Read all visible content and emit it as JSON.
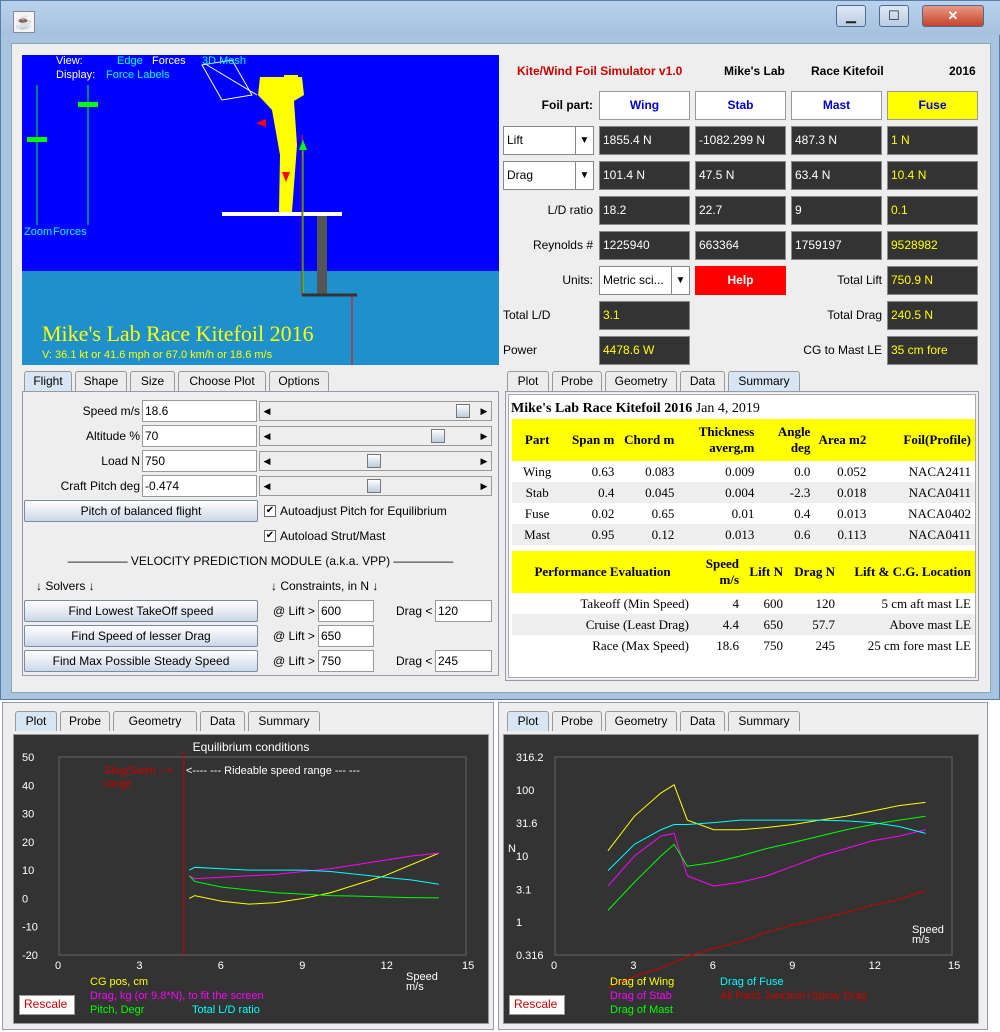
{
  "window": {
    "min_label": "▁",
    "max_label": "☐",
    "close_label": "✕",
    "app_icon": "java-cup-icon"
  },
  "scene": {
    "view_label": "View:",
    "edge_label": "Edge",
    "forces_label": "Forces",
    "mesh_label": "3D Mesh",
    "display_label": "Display:",
    "force_labels_label": "Force Labels",
    "zoom_label": "Zoom",
    "forces_slider_label": "Forces",
    "title": "Mike's Lab Race Kitefoil 2016",
    "velocity": "V: 36.1 kt or 41.6 mph or 67.0 km/h or 18.6 m/s"
  },
  "header": {
    "app_name": "Kite/Wind Foil Simulator v1.0",
    "lab": "Mike's Lab",
    "project": "Race Kitefoil",
    "year": "2016"
  },
  "foil": {
    "part_label": "Foil part:",
    "parts": [
      "Wing",
      "Stab",
      "Mast",
      "Fuse"
    ],
    "lift_select": "Lift",
    "drag_select": "Drag",
    "lift": [
      "1855.4 N",
      "-1082.299 N",
      "487.3 N",
      "1 N"
    ],
    "drag": [
      "101.4 N",
      "47.5 N",
      "63.4 N",
      "10.4 N"
    ],
    "ld_label": "L/D ratio",
    "ld": [
      "18.2",
      "22.7",
      "9",
      "0.1"
    ],
    "re_label": "Reynolds #",
    "re": [
      "1225940",
      "663364",
      "1759197",
      "9528982"
    ],
    "units_label": "Units:",
    "units_value": "Metric sci...",
    "help": "Help",
    "total_lift_label": "Total Lift",
    "total_lift": "750.9 N",
    "total_ld_label": "Total L/D",
    "total_ld": "3.1",
    "total_drag_label": "Total Drag",
    "total_drag": "240.5 N",
    "power_label": "Power",
    "power": "4478.6 W",
    "cg_label": "CG to Mast LE",
    "cg": "35 cm fore"
  },
  "left_tabs": [
    "Flight",
    "Shape",
    "Size",
    "Choose Plot",
    "Options"
  ],
  "flight": {
    "speed_label": "Speed m/s",
    "speed": "18.6",
    "alt_label": "Altitude %",
    "alt": "70",
    "load_label": "Load N",
    "load": "750",
    "pitch_label": "Craft Pitch deg",
    "pitch": "-0.474",
    "balanced_btn": "Pitch of balanced flight",
    "autoadjust": "Autoadjust Pitch for Equilibrium",
    "autoload": "Autoload Strut/Mast",
    "vpp_title": "—————  VELOCITY PREDICTION MODULE (a.k.a. VPP)  —————",
    "solvers": "↓   Solvers   ↓",
    "constraints": "↓   Constraints, in N   ↓",
    "btn1": "Find Lowest TakeOff speed",
    "btn2": "Find Speed of lesser Drag",
    "btn3": "Find Max Possible Steady Speed",
    "atlift": "@ Lift >",
    "drag_lt": "Drag <",
    "c1_lift": "600",
    "c1_drag": "120",
    "c2_lift": "650",
    "c3_lift": "750",
    "c3_drag": "245"
  },
  "right_tabs": [
    "Plot",
    "Probe",
    "Geometry",
    "Data",
    "Summary"
  ],
  "summary": {
    "heading": "Mike's Lab Race Kitefoil 2016",
    "date": "Jan 4, 2019",
    "headers": [
      "Part",
      "Span m",
      "Chord m",
      "Thickness averg,m",
      "Angle deg",
      "Area m2",
      "Foil(Profile)"
    ],
    "rows": [
      [
        "Wing",
        "0.63",
        "0.083",
        "0.009",
        "0.0",
        "0.052",
        "NACA2411"
      ],
      [
        "Stab",
        "0.4",
        "0.045",
        "0.004",
        "-2.3",
        "0.018",
        "NACA0411"
      ],
      [
        "Fuse",
        "0.02",
        "0.65",
        "0.01",
        "0.4",
        "0.013",
        "NACA0402"
      ],
      [
        "Mast",
        "0.95",
        "0.12",
        "0.013",
        "0.6",
        "0.113",
        "NACA0411"
      ]
    ],
    "perf_headers": [
      "Performance Evaluation",
      "Speed m/s",
      "Lift N",
      "Drag N",
      "Lift & C.G. Location"
    ],
    "perf_rows": [
      [
        "Takeoff (Min Speed)",
        "4",
        "600",
        "120",
        "5 cm aft mast LE"
      ],
      [
        "Cruise (Least Drag)",
        "4.4",
        "650",
        "57.7",
        "Above mast LE"
      ],
      [
        "Race (Max Speed)",
        "18.6",
        "750",
        "245",
        "25 cm fore mast LE"
      ]
    ]
  },
  "bottom_tabs": [
    "Plot",
    "Probe",
    "Geometry",
    "Data",
    "Summary"
  ],
  "plot1": {
    "title": "Equilibrium conditions",
    "slog_label": "Slog/Swim -->",
    "range_label": "range",
    "rideable": "<---- --- Rideable speed range --- ---",
    "xlabel": "Speed m/s",
    "xticks": [
      "0",
      "3",
      "6",
      "9",
      "12",
      "15"
    ],
    "yticks": [
      "50",
      "40",
      "30",
      "20",
      "10",
      "0",
      "-10",
      "-20"
    ],
    "legend": [
      "CG pos, cm",
      "Drag, kg (or 9.8*N), to fit the screen",
      "Pitch, Degr",
      "Total L/D ratio"
    ],
    "rescale": "Rescale"
  },
  "plot2": {
    "ylabel": "N",
    "xlabel": "Speed m/s",
    "xticks": [
      "0",
      "3",
      "6",
      "9",
      "12",
      "15"
    ],
    "yticks": [
      "316.2",
      "100",
      "31.6",
      "10",
      "3.1",
      "1",
      "0.316"
    ],
    "legend": [
      "Drag of Wing",
      "Drag of Stab",
      "Drag of Mast",
      "Drag of Fuse",
      "All Parts Junction+Spray Drag"
    ],
    "rescale": "Rescale"
  },
  "chart_data": [
    {
      "type": "line",
      "title": "Equilibrium conditions",
      "xlabel": "Speed m/s",
      "ylabel": "",
      "xlim": [
        0,
        15
      ],
      "ylim": [
        -20,
        50
      ],
      "series": [
        {
          "name": "CG pos, cm",
          "color": "#ffff00",
          "x": [
            4.8,
            5,
            6,
            7,
            8,
            9,
            10,
            11,
            12,
            13,
            14
          ],
          "y": [
            0,
            1,
            -1,
            -2,
            -1.5,
            0,
            2,
            5,
            8,
            12,
            16
          ]
        },
        {
          "name": "Drag, kg (or 9.8*N), to fit the screen",
          "color": "#ff00ff",
          "x": [
            4.8,
            5,
            6,
            7,
            8,
            9,
            10,
            11,
            12,
            13,
            14
          ],
          "y": [
            8,
            7,
            7.5,
            8,
            8.5,
            9.5,
            10.5,
            12,
            13.5,
            15,
            16
          ]
        },
        {
          "name": "Pitch, Degr",
          "color": "#00ff00",
          "x": [
            4.8,
            5,
            6,
            7,
            8,
            9,
            10,
            11,
            12,
            13,
            14
          ],
          "y": [
            8,
            6,
            4,
            3,
            2,
            1.5,
            1,
            0.8,
            0.5,
            0.3,
            0.2
          ]
        },
        {
          "name": "Total L/D ratio",
          "color": "#00ffff",
          "x": [
            4.8,
            5,
            6,
            7,
            8,
            9,
            10,
            11,
            12,
            13,
            14
          ],
          "y": [
            10,
            11,
            10.5,
            10,
            10,
            10,
            9.5,
            8.5,
            7.5,
            6.5,
            5
          ]
        }
      ]
    },
    {
      "type": "line",
      "xlabel": "Speed m/s",
      "ylabel": "N",
      "xlim": [
        0,
        15
      ],
      "ylim": [
        0.316,
        316.2
      ],
      "yscale": "log",
      "series": [
        {
          "name": "Drag of Wing",
          "color": "#ffff00",
          "x": [
            2,
            3,
            4,
            4.5,
            5,
            6,
            7,
            8,
            9,
            10,
            11,
            12,
            13,
            14
          ],
          "y": [
            12,
            40,
            90,
            120,
            35,
            25,
            25,
            27,
            30,
            35,
            40,
            48,
            58,
            65
          ]
        },
        {
          "name": "Drag of Stab",
          "color": "#ff00ff",
          "x": [
            2,
            3,
            4,
            4.5,
            5,
            6,
            7,
            8,
            9,
            10,
            11,
            12,
            13,
            14
          ],
          "y": [
            3.5,
            10,
            20,
            22,
            5,
            3.5,
            4,
            5,
            7,
            10,
            13,
            17,
            20,
            25
          ]
        },
        {
          "name": "Drag of Mast",
          "color": "#00ff00",
          "x": [
            2,
            3,
            4,
            4.5,
            5,
            6,
            7,
            8,
            9,
            10,
            11,
            12,
            13,
            14
          ],
          "y": [
            1.5,
            4,
            10,
            15,
            7,
            8,
            10,
            13,
            16,
            20,
            25,
            30,
            35,
            40
          ]
        },
        {
          "name": "Drag of Fuse",
          "color": "#00ffff",
          "x": [
            2,
            3,
            4,
            4.5,
            5,
            6,
            7,
            8,
            9,
            10,
            11,
            12,
            13,
            14
          ],
          "y": [
            6,
            15,
            25,
            30,
            30,
            32,
            35,
            35,
            35,
            35,
            34,
            32,
            28,
            22
          ]
        },
        {
          "name": "All Parts Junction+Spray Drag",
          "color": "#cc0000",
          "x": [
            2,
            3,
            4,
            5,
            6,
            7,
            8,
            9,
            10,
            11,
            12,
            13,
            14
          ],
          "y": [
            0.1,
            0.15,
            0.2,
            0.3,
            0.4,
            0.5,
            0.7,
            0.9,
            1.1,
            1.4,
            1.8,
            2.2,
            3
          ]
        }
      ]
    }
  ]
}
